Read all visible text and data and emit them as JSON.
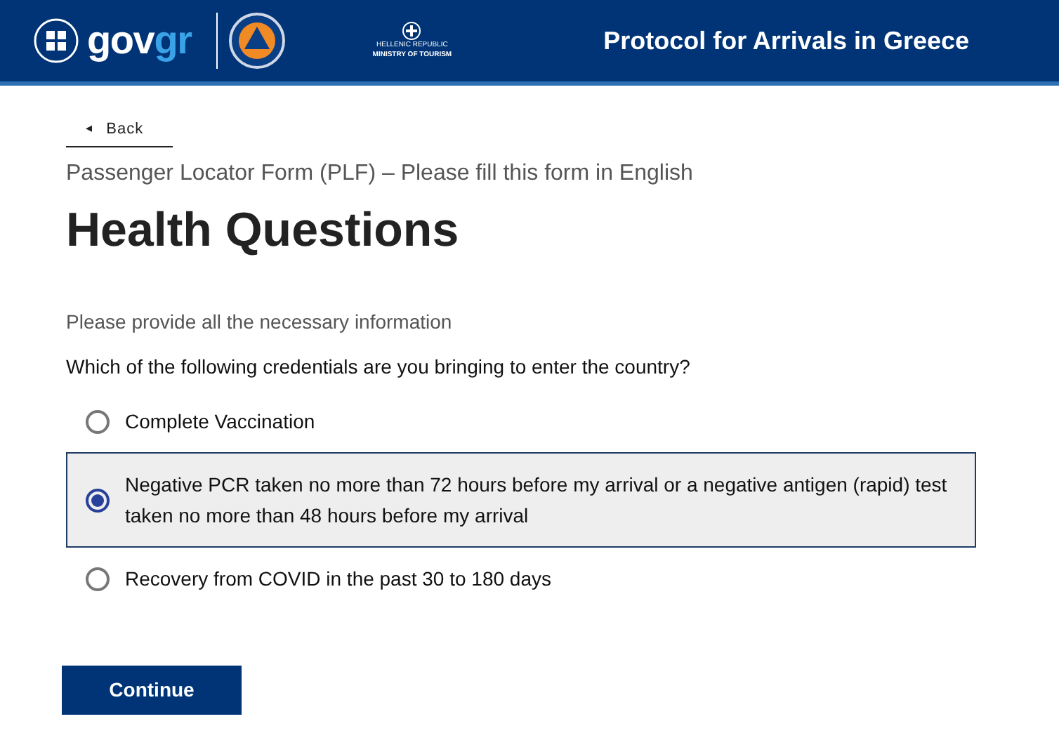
{
  "header": {
    "logo": {
      "part_1": "gov",
      "part_2": "gr"
    },
    "ministry": {
      "line_1": "HELLENIC REPUBLIC",
      "line_2": "MINISTRY OF TOURISM"
    },
    "title": "Protocol for Arrivals in Greece"
  },
  "back_link": {
    "icon": "◂",
    "label": "Back"
  },
  "caption": "Passenger Locator Form (PLF) – Please fill this form in English",
  "heading": "Health Questions",
  "hint": "Please provide all the necessary information",
  "question": "Which of the following credentials are you bringing to enter the country?",
  "options": [
    {
      "label": "Complete Vaccination",
      "selected": false
    },
    {
      "label": "Negative PCR taken no more than 72 hours before my arrival or a negative antigen (rapid) test taken no more than 48 hours before my arrival",
      "selected": true
    },
    {
      "label": "Recovery from COVID in the past 30 to 180 days",
      "selected": false
    }
  ],
  "continue_button": "Continue"
}
